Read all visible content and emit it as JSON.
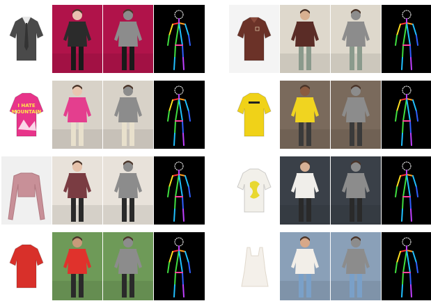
{
  "figure": {
    "rows": 4,
    "groups": [
      {
        "side": "left",
        "samples": [
          {
            "garment": "tie-uniform-shirt",
            "garment_colors": {
              "primary": "#4a4a4a",
              "accent": "#e8e8e8",
              "background": "#ffffff"
            },
            "scene_colors": {
              "background": "#b0134a",
              "skin": "#e8c0b0",
              "top": "#2b2b2b",
              "bottom": "#1a1a1a"
            }
          },
          {
            "garment": "sweater-i-hate-mountain",
            "garment_text": [
              "I HATE",
              "MOUNTAIN"
            ],
            "garment_colors": {
              "primary": "#e8348a",
              "accent": "#ffe54a",
              "background": "#ffffff"
            },
            "scene_colors": {
              "background": "#d8d2c8",
              "skin": "#e8c6b0",
              "top": "#e43e8e",
              "bottom": "#e8e0cc"
            }
          },
          {
            "garment": "long-sleeve-crop-top",
            "garment_colors": {
              "primary": "#c89098",
              "accent": "#b07880",
              "background": "#f0f0f0"
            },
            "scene_colors": {
              "background": "#e8e2da",
              "skin": "#e6c2aa",
              "top": "#7a3c42",
              "bottom": "#2a2a2a"
            }
          },
          {
            "garment": "red-tshirt",
            "garment_colors": {
              "primary": "#d8302a",
              "accent": "#b42420",
              "background": "#ffffff"
            },
            "scene_colors": {
              "background": "#6e9a58",
              "skin": "#c89a7a",
              "top": "#e0322c",
              "bottom": "#2a2a2a"
            }
          }
        ]
      },
      {
        "side": "right",
        "samples": [
          {
            "garment": "brown-polo-sweater",
            "garment_colors": {
              "primary": "#6b3228",
              "accent": "#8a4a3c",
              "background": "#f4f4f4"
            },
            "scene_colors": {
              "background": "#ded8cc",
              "skin": "#d8b090",
              "top": "#5a2c26",
              "bottom": "#8a9a8c"
            }
          },
          {
            "garment": "yellow-tshirt",
            "garment_colors": {
              "primary": "#f0d218",
              "accent": "#c8ac10",
              "background": "#ffffff"
            },
            "scene_colors": {
              "background": "#7a6a5c",
              "skin": "#8a5a40",
              "top": "#f0d420",
              "bottom": "#3a3a3a"
            }
          },
          {
            "garment": "white-tshirt-yellow-print",
            "garment_colors": {
              "primary": "#f2f0ea",
              "accent": "#e8d830",
              "background": "#ffffff"
            },
            "scene_colors": {
              "background": "#3a4048",
              "skin": "#d8b094",
              "top": "#f0eeea",
              "bottom": "#2a2a2a"
            }
          },
          {
            "garment": "white-camisole",
            "garment_colors": {
              "primary": "#f4f0ea",
              "accent": "#e0d8cc",
              "background": "#ffffff"
            },
            "scene_colors": {
              "background": "#8aa0b8",
              "skin": "#d8a888",
              "top": "#f2eee8",
              "bottom": "#7aa0c8"
            }
          }
        ]
      }
    ],
    "mask_color": "#8c8c8c",
    "pose_background": "#000000",
    "limb_colors": [
      "#ff3030",
      "#ff9a20",
      "#ffe020",
      "#40e040",
      "#20c0ff",
      "#3060ff",
      "#c040ff",
      "#ff40a0"
    ]
  }
}
